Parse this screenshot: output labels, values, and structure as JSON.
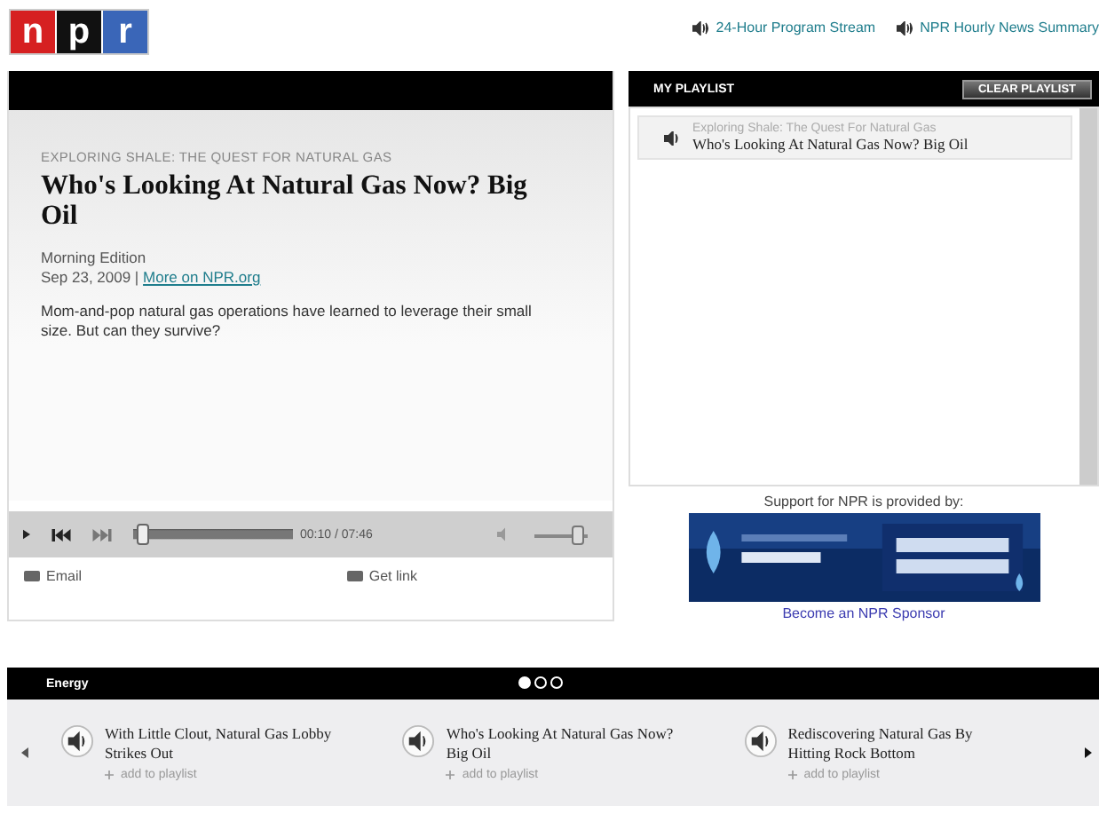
{
  "header": {
    "logo": [
      "n",
      "p",
      "r"
    ],
    "streams": [
      {
        "label": "24-Hour Program Stream"
      },
      {
        "label": "NPR Hourly News Summary"
      }
    ]
  },
  "story": {
    "series": "EXPLORING SHALE: THE QUEST FOR NATURAL GAS",
    "title": "Who's Looking At Natural Gas Now? Big Oil",
    "program": "Morning Edition",
    "date": "Sep 23, 2009 |",
    "link": "More on NPR.org",
    "teaser": "Mom-and-pop natural gas operations have learned to leverage their small size. But can they survive?"
  },
  "player": {
    "progress": {
      "level": 0.02
    },
    "time": "00:10 / 07:46",
    "volume": {
      "level": 0.92
    }
  },
  "actions": [
    {
      "label": "Email"
    },
    {
      "label": "Get link"
    }
  ],
  "playlist": {
    "title": "MY PLAYLIST",
    "clear_button": "CLEAR PLAYLIST",
    "items": [
      {
        "series": "Exploring Shale: The Quest For Natural Gas",
        "title": "Who's Looking At Natural Gas Now? Big Oil"
      }
    ]
  },
  "sponsor": {
    "caption": "Support for NPR is provided by:",
    "link": "Become an NPR Sponsor"
  },
  "carousel": {
    "title": "Energy",
    "pages": [
      {
        "selected": true
      },
      {
        "selected": false
      },
      {
        "selected": false
      }
    ],
    "items": [
      {
        "title": "With Little Clout, Natural Gas Lobby Strikes Out",
        "add": "add to playlist"
      },
      {
        "title": "Who's Looking At Natural Gas Now? Big Oil",
        "add": "add to playlist"
      },
      {
        "title": "Rediscovering Natural Gas By Hitting Rock Bottom",
        "add": "add to playlist"
      }
    ]
  }
}
